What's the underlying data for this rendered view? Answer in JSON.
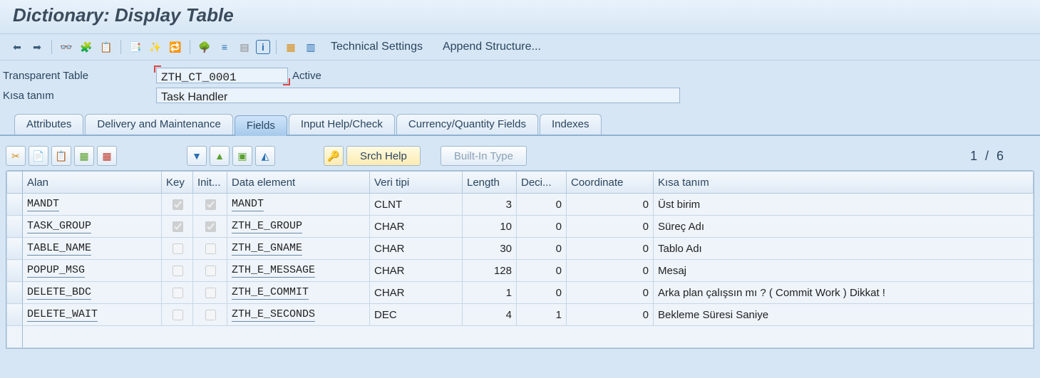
{
  "title": "Dictionary: Display Table",
  "toolbar_text": {
    "technical_settings": "Technical Settings",
    "append_structure": "Append Structure..."
  },
  "header": {
    "table_label": "Transparent Table",
    "table_name": "ZTH_CT_0001",
    "status": "Active",
    "desc_label": "Kısa tanım",
    "desc_value": "Task Handler"
  },
  "tabs": [
    {
      "label": "Attributes"
    },
    {
      "label": "Delivery and Maintenance"
    },
    {
      "label": "Fields",
      "active": true
    },
    {
      "label": "Input Help/Check"
    },
    {
      "label": "Currency/Quantity Fields"
    },
    {
      "label": "Indexes"
    }
  ],
  "inner_buttons": {
    "srch_help": "Srch Help",
    "built_in_type": "Built-In Type"
  },
  "row_counter": "1  /  6",
  "columns": {
    "alan": "Alan",
    "key": "Key",
    "init": "Init...",
    "data_element": "Data element",
    "veri_tipi": "Veri tipi",
    "length": "Length",
    "deci": "Deci...",
    "coord": "Coordinate",
    "desc": "Kısa tanım"
  },
  "rows": [
    {
      "alan": "MANDT",
      "key": true,
      "init": true,
      "de": "MANDT",
      "vt": "CLNT",
      "len": "3",
      "dec": "0",
      "coord": "0",
      "desc": "Üst birim"
    },
    {
      "alan": "TASK_GROUP",
      "key": true,
      "init": true,
      "de": "ZTH_E_GROUP",
      "vt": "CHAR",
      "len": "10",
      "dec": "0",
      "coord": "0",
      "desc": "Süreç Adı"
    },
    {
      "alan": "TABLE_NAME",
      "key": false,
      "init": false,
      "de": "ZTH_E_GNAME",
      "vt": "CHAR",
      "len": "30",
      "dec": "0",
      "coord": "0",
      "desc": "Tablo Adı"
    },
    {
      "alan": "POPUP_MSG",
      "key": false,
      "init": false,
      "de": "ZTH_E_MESSAGE",
      "vt": "CHAR",
      "len": "128",
      "dec": "0",
      "coord": "0",
      "desc": "Mesaj"
    },
    {
      "alan": "DELETE_BDC",
      "key": false,
      "init": false,
      "de": "ZTH_E_COMMIT",
      "vt": "CHAR",
      "len": "1",
      "dec": "0",
      "coord": "0",
      "desc": "Arka plan çalışsın mı ? ( Commit Work ) Dikkat !"
    },
    {
      "alan": "DELETE_WAIT",
      "key": false,
      "init": false,
      "de": "ZTH_E_SECONDS",
      "vt": "DEC",
      "len": "4",
      "dec": "1",
      "coord": "0",
      "desc": "Bekleme Süresi Saniye"
    }
  ]
}
